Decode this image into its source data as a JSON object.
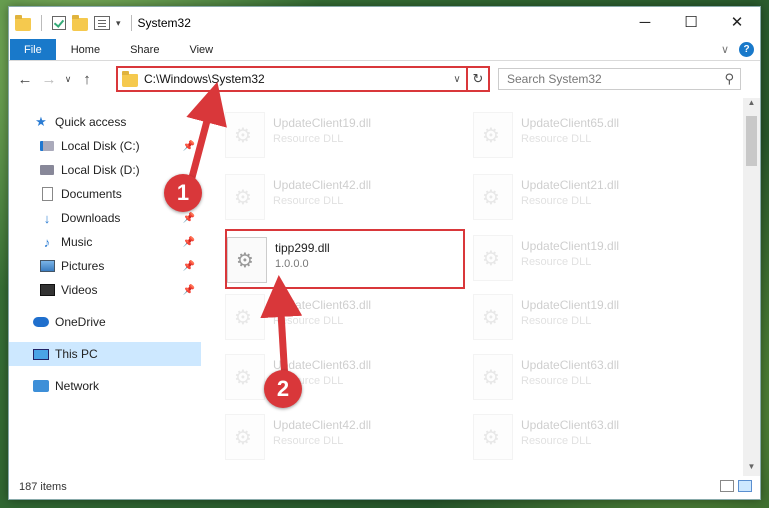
{
  "window": {
    "title": "System32",
    "controls": {
      "minimize": "─",
      "maximize": "☐",
      "close": "✕"
    }
  },
  "ribbon": {
    "tabs": [
      "File",
      "Home",
      "Share",
      "View"
    ],
    "expand": "∨",
    "help": "?"
  },
  "address": {
    "path": "C:\\Windows\\System32",
    "search_placeholder": "Search System32"
  },
  "nav": {
    "quick_access": "Quick access",
    "items": [
      {
        "label": "Local Disk (C:)",
        "icon": "drive-icon",
        "pinned": true
      },
      {
        "label": "Local Disk (D:)",
        "icon": "drive-icon",
        "pinned": false
      },
      {
        "label": "Documents",
        "icon": "documents-icon",
        "pinned": true
      },
      {
        "label": "Downloads",
        "icon": "downloads-icon",
        "pinned": true
      },
      {
        "label": "Music",
        "icon": "music-icon",
        "pinned": true
      },
      {
        "label": "Pictures",
        "icon": "pictures-icon",
        "pinned": true
      },
      {
        "label": "Videos",
        "icon": "videos-icon",
        "pinned": true
      }
    ],
    "onedrive": "OneDrive",
    "this_pc": "This PC",
    "network": "Network"
  },
  "files": {
    "col1": [
      {
        "name": "UpdateClient19.dll",
        "sub": "Resource DLL"
      },
      {
        "name": "UpdateClient42.dll",
        "sub": "Resource DLL"
      },
      {
        "name": "tipp299.dll",
        "sub": "1.0.0.0"
      },
      {
        "name": "UpdateClient63.dll",
        "sub": "Resource DLL"
      },
      {
        "name": "UpdateClient63.dll",
        "sub": "Resource DLL"
      },
      {
        "name": "UpdateClient42.dll",
        "sub": "Resource DLL"
      }
    ],
    "col2": [
      {
        "name": "UpdateClient65.dll",
        "sub": "Resource DLL"
      },
      {
        "name": "UpdateClient21.dll",
        "sub": "Resource DLL"
      },
      {
        "name": "UpdateClient19.dll",
        "sub": "Resource DLL"
      },
      {
        "name": "UpdateClient19.dll",
        "sub": "Resource DLL"
      },
      {
        "name": "UpdateClient63.dll",
        "sub": "Resource DLL"
      },
      {
        "name": "UpdateClient63.dll",
        "sub": "Resource DLL"
      }
    ]
  },
  "status": {
    "count": "187 items"
  },
  "annotations": {
    "step1": "1",
    "step2": "2",
    "color": "#d9373a"
  }
}
